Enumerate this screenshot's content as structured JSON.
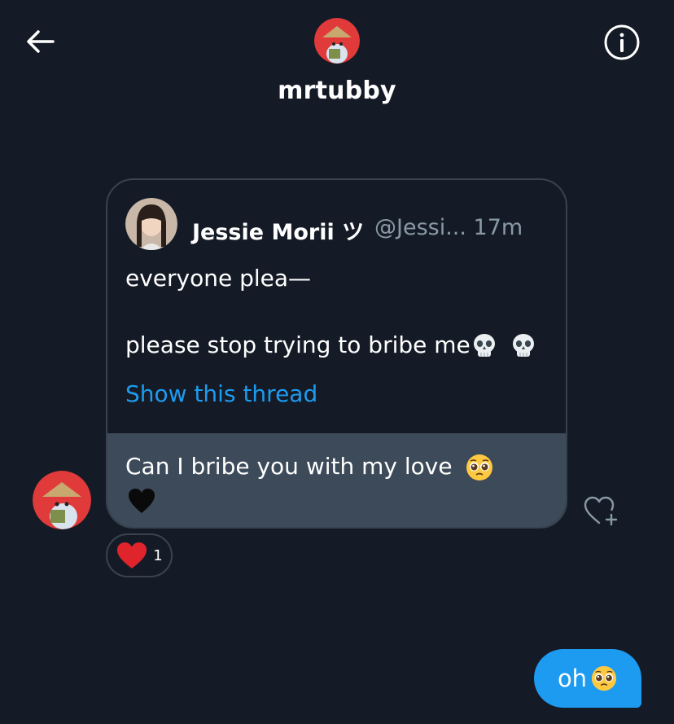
{
  "header": {
    "back_icon": "arrow-left-icon",
    "title": "mrtubby",
    "info_icon": "info-icon"
  },
  "quoted_tweet": {
    "author": "Jessie Morii ツ",
    "handle_time": "@Jessi...  17m",
    "line1": "everyone plea—",
    "line2": "please stop trying to bribe me",
    "line2_emoji": "skull-emoji skull-emoji",
    "show_thread": "Show this thread"
  },
  "received_message": {
    "text": "Can I bribe you with my love",
    "emoji": "pleading-face-emoji",
    "second_line_emoji": "black-heart-emoji",
    "reaction_count": "1",
    "react_icon": "heart-plus-icon"
  },
  "sent_message": {
    "text": "oh",
    "emoji": "pleading-face-emoji"
  },
  "colors": {
    "background": "#151b26",
    "accent": "#1d9bf0",
    "card_border": "#38434f",
    "reply_bubble": "#3d4a59",
    "muted_text": "#8899a6"
  }
}
